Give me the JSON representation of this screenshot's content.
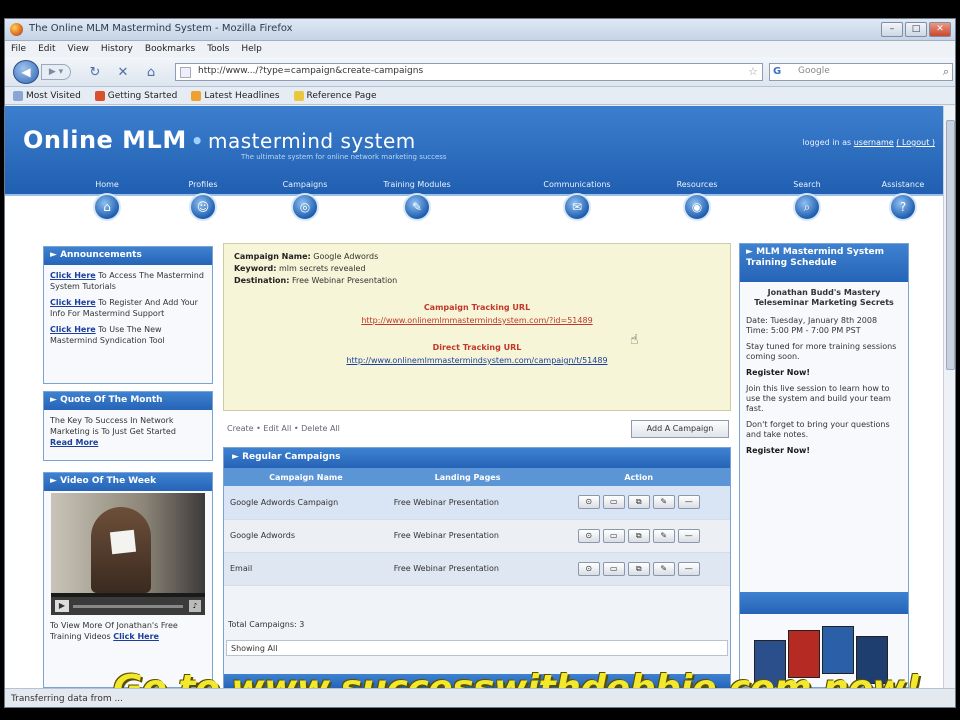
{
  "browser": {
    "window_title": "The Online MLM Mastermind System - Mozilla Firefox",
    "menu": [
      "File",
      "Edit",
      "View",
      "History",
      "Bookmarks",
      "Tools",
      "Help"
    ],
    "url": "http://www.../?type=campaign&create-campaigns",
    "search_placeholder": "Google",
    "bookmarks": [
      "Most Visited",
      "Getting Started",
      "Latest Headlines",
      "Reference Page"
    ],
    "status_text": "Transferring data from ...",
    "window_buttons": [
      "–",
      "□",
      "✕"
    ]
  },
  "site": {
    "brand_left": "Online MLM",
    "brand_right": "mastermind system",
    "tagline": "The ultimate system for online network marketing success",
    "login_text": "logged in as",
    "login_user": "username",
    "logout_label": "( Logout )",
    "nav": [
      {
        "label": "Home",
        "icon": "home-icon"
      },
      {
        "label": "Profiles",
        "icon": "user-icon"
      },
      {
        "label": "Campaigns",
        "icon": "target-icon"
      },
      {
        "label": "Training Modules",
        "icon": "book-icon"
      },
      {
        "label": "Communications",
        "icon": "chat-icon"
      },
      {
        "label": "Resources",
        "icon": "globe-icon"
      },
      {
        "label": "Search",
        "icon": "search-icon"
      },
      {
        "label": "Assistance",
        "icon": "help-icon"
      }
    ]
  },
  "left": {
    "announcements_title": "Announcements",
    "announcements": [
      {
        "link": "Click Here",
        "text": "To Access The Mastermind System Tutorials"
      },
      {
        "link": "Click Here",
        "text": "To Register And Add Your Info For Mastermind Support"
      },
      {
        "link": "Click Here",
        "text": "To Use The New Mastermind Syndication Tool"
      }
    ],
    "quote_title": "Quote Of The Month",
    "quote_text": "The Key To Success In Network Marketing is To Just Get Started",
    "quote_link": "Read More",
    "video_title": "Video Of The Week",
    "video_caption": "To View More Of Jonathan's Free Training Videos",
    "video_link": "Click Here"
  },
  "center": {
    "fields": [
      {
        "k": "Campaign Name:",
        "v": "Google Adwords"
      },
      {
        "k": "Keyword:",
        "v": "mlm secrets revealed"
      },
      {
        "k": "Destination:",
        "v": "Free Webinar Presentation"
      }
    ],
    "link1_title": "Campaign Tracking URL",
    "link1_url": "http://www.onlinemlmmastermindsystem.com/?id=51489",
    "link2_title": "Direct Tracking URL",
    "link2_url": "http://www.onlinemlmmastermindsystem.com/campaign/t/51489",
    "tabs": "Create  •  Edit All  •  Delete All",
    "add_button": "Add A Campaign",
    "campaigns_title": "Regular Campaigns",
    "columns": [
      "Campaign Name",
      "Landing Pages",
      "Action"
    ],
    "rows": [
      {
        "name": "Google Adwords Campaign",
        "page": "Free Webinar Presentation"
      },
      {
        "name": "Google Adwords",
        "page": "Free Webinar Presentation"
      },
      {
        "name": "Email",
        "page": "Free Webinar Presentation"
      }
    ],
    "row_actions": [
      "⊙",
      "▭",
      "⧉",
      "✎",
      "—"
    ],
    "total_label": "Total Campaigns: 3",
    "showing": "Showing All"
  },
  "right": {
    "title": "MLM Mastermind System Training Schedule",
    "event_title": "Jonathan Budd's Mastery Teleseminar Marketing Secrets",
    "date_line": "Date: Tuesday, January 8th 2008",
    "time_line": "Time: 5:00 PM - 7:00 PM PST",
    "desc1": "Stay tuned for more training sessions coming soon.",
    "register1": "Register Now!",
    "desc2": "Join this live session to learn how to use the system and build your team fast.",
    "desc3": "Don't forget to bring your questions and take notes.",
    "register2": "Register Now!"
  },
  "overlay_text": "Go to www.successwithdebbie.com now!",
  "colors": {
    "header_blue": "#2563b6",
    "overlay_yellow": "#f2e92e",
    "panel_yellow": "#f7f5d8"
  }
}
